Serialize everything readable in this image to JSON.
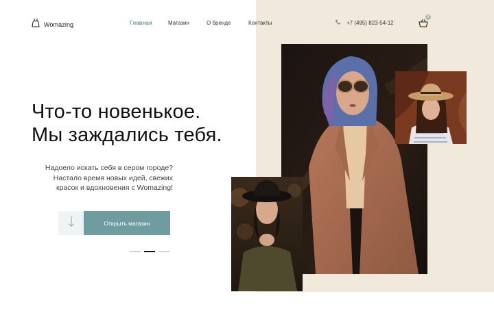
{
  "header": {
    "logo_text": "Womazing",
    "nav": [
      {
        "label": "Главная",
        "active": true
      },
      {
        "label": "Магазин",
        "active": false
      },
      {
        "label": "О бренде",
        "active": false
      },
      {
        "label": "Контакты",
        "active": false
      }
    ],
    "phone": "+7 (495) 823-54-12",
    "cart_count": "0"
  },
  "hero": {
    "title_line1": "Что-то новенькое.",
    "title_line2": "Мы заждались тебя.",
    "subtitle_line1": "Надоело искать себя в сером городе?",
    "subtitle_line2": "Настало время новых идей, свежих",
    "subtitle_line3": "красок и вдохновения с Womazing!",
    "cta_label": "Открыть магазин",
    "slides": 3,
    "active_slide": 2
  },
  "icons": {
    "logo": "dress-icon",
    "phone": "phone-icon",
    "cart": "basket-icon",
    "scroll": "arrow-down-icon"
  },
  "colors": {
    "accent": "#6e9c9f",
    "beige": "#f1eadc"
  }
}
